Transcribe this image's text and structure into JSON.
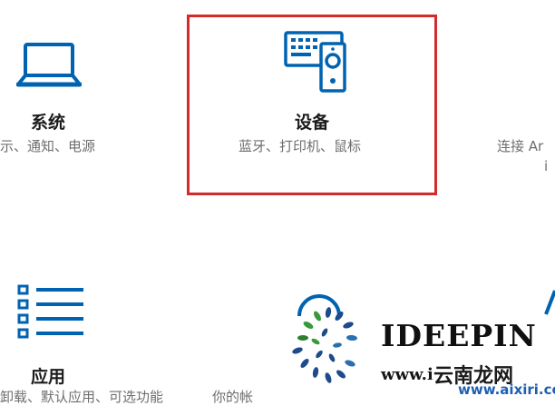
{
  "tiles": {
    "system": {
      "title": "系统",
      "subtitle": "示、通知、电源"
    },
    "devices": {
      "title": "设备",
      "subtitle": "蓝牙、打印机、鼠标"
    },
    "phone": {
      "subtitle": "连接 Ar",
      "subtitle2": "i"
    },
    "apps": {
      "title": "应用",
      "subtitle": "卸载、默认应用、可选功能"
    },
    "accounts": {
      "subtitle": "你的帐"
    }
  },
  "watermark": {
    "brand": "IDEEPIN",
    "url": "www.i",
    "chinese": "云南龙网",
    "domain": "www.aixiri.com"
  },
  "colors": {
    "accent": "#0063b1",
    "highlight": "#d42a2a"
  },
  "icons": {
    "system": "laptop-icon",
    "devices": "keyboard-speaker-icon",
    "apps": "list-icon",
    "accounts": "person-icon"
  }
}
